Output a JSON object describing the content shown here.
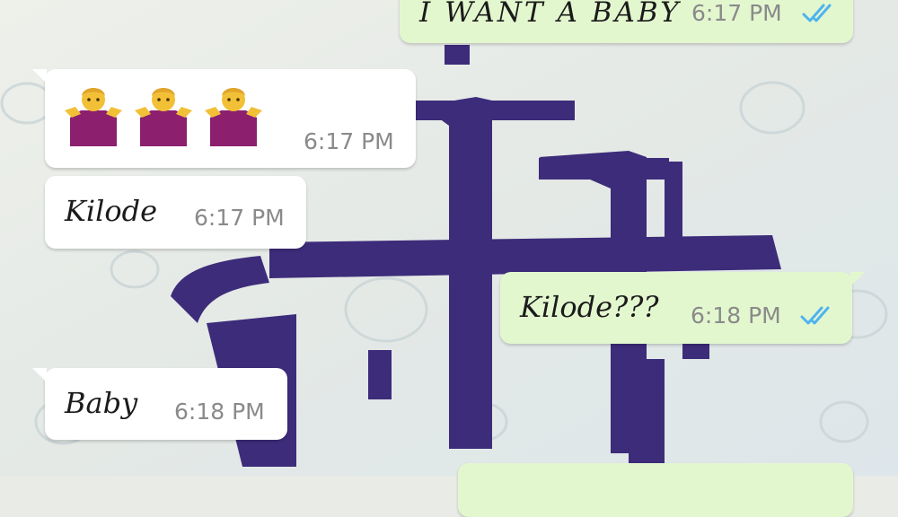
{
  "chat": {
    "messages": [
      {
        "direction": "outgoing",
        "text": "I WANT A BABY",
        "time": "6:17 PM",
        "status_icon": "double-check-icon"
      },
      {
        "direction": "incoming",
        "emoji": [
          "🤷‍♂️",
          "🤷‍♂️",
          "🤷‍♂️"
        ],
        "time": "6:17 PM"
      },
      {
        "direction": "incoming",
        "text": "Kilode",
        "time": "6:17 PM"
      },
      {
        "direction": "outgoing",
        "text": "Kilode???",
        "time": "6:18 PM",
        "status_icon": "double-check-icon"
      },
      {
        "direction": "incoming",
        "text": "Baby",
        "time": "6:18 PM"
      }
    ]
  },
  "colors": {
    "incoming_bubble": "#ffffff",
    "outgoing_bubble": "#e3f7cf",
    "read_tick": "#4fb3f0",
    "wallpaper_logo": "#3d2c7a"
  }
}
